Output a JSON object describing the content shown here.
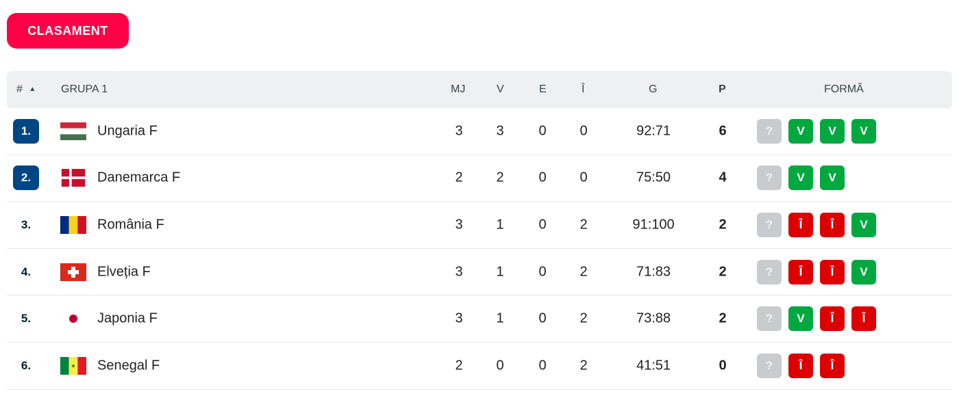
{
  "tab": {
    "label": "CLASAMENT"
  },
  "header": {
    "rank": "#",
    "group": "GRUPA 1",
    "mj": "MJ",
    "v": "V",
    "e": "E",
    "i": "Î",
    "g": "G",
    "p": "P",
    "form": "FORMĂ"
  },
  "colors": {
    "accent": "#ff0046",
    "rank_highlight": "#004682",
    "win": "#00a83f",
    "loss": "#dc0000",
    "unknown": "#c8ccce"
  },
  "rows": [
    {
      "rank": "1.",
      "highlight": true,
      "flag": "hungary-flag",
      "team": "Ungaria F",
      "mj": "3",
      "v": "3",
      "e": "0",
      "i": "0",
      "g": "92:71",
      "p": "6",
      "form": [
        "?",
        "V",
        "V",
        "V"
      ]
    },
    {
      "rank": "2.",
      "highlight": true,
      "flag": "denmark-flag",
      "team": "Danemarca F",
      "mj": "2",
      "v": "2",
      "e": "0",
      "i": "0",
      "g": "75:50",
      "p": "4",
      "form": [
        "?",
        "V",
        "V"
      ]
    },
    {
      "rank": "3.",
      "highlight": false,
      "flag": "romania-flag",
      "team": "România F",
      "mj": "3",
      "v": "1",
      "e": "0",
      "i": "2",
      "g": "91:100",
      "p": "2",
      "form": [
        "?",
        "Î",
        "Î",
        "V"
      ]
    },
    {
      "rank": "4.",
      "highlight": false,
      "flag": "switzerland-flag",
      "team": "Elveția F",
      "mj": "3",
      "v": "1",
      "e": "0",
      "i": "2",
      "g": "71:83",
      "p": "2",
      "form": [
        "?",
        "Î",
        "Î",
        "V"
      ]
    },
    {
      "rank": "5.",
      "highlight": false,
      "flag": "japan-flag",
      "team": "Japonia F",
      "mj": "3",
      "v": "1",
      "e": "0",
      "i": "2",
      "g": "73:88",
      "p": "2",
      "form": [
        "?",
        "V",
        "Î",
        "Î"
      ]
    },
    {
      "rank": "6.",
      "highlight": false,
      "flag": "senegal-flag",
      "team": "Senegal F",
      "mj": "2",
      "v": "0",
      "e": "0",
      "i": "2",
      "g": "41:51",
      "p": "0",
      "form": [
        "?",
        "Î",
        "Î"
      ]
    }
  ]
}
